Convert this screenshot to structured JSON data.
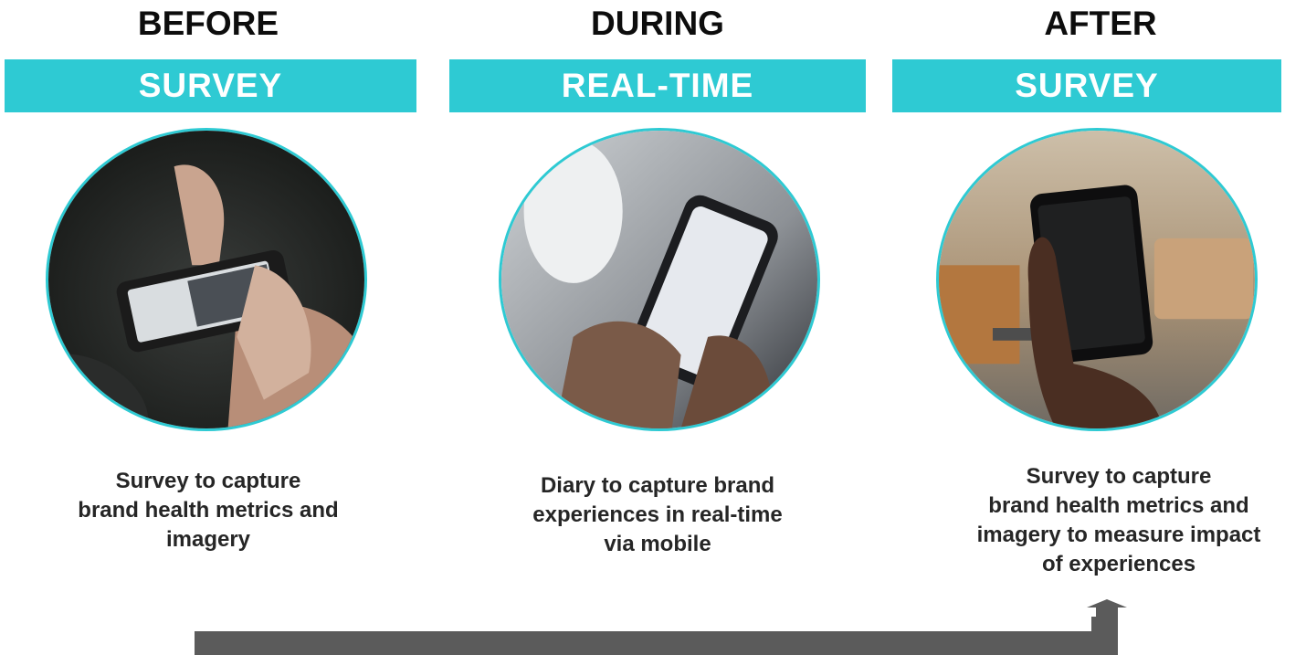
{
  "stages": [
    {
      "phase": "BEFORE",
      "method": "SURVEY",
      "image_icon": "hand-typing-on-phone-keyboard",
      "description": "Survey to capture brand health metrics  and imagery",
      "description_lines": [
        "Survey to capture",
        "brand health metrics  and",
        "imagery"
      ]
    },
    {
      "phase": "DURING",
      "method": "REAL-TIME",
      "image_icon": "hands-holding-phone-on-plane",
      "description": "Diary to capture brand experiences in real-time via mobile",
      "description_lines": [
        "Diary to capture brand",
        "experiences in real-time",
        "via mobile"
      ]
    },
    {
      "phase": "AFTER",
      "method": "SURVEY",
      "image_icon": "hand-holding-black-phone",
      "description": "Survey to capture brand health metrics and imagery to measure impact of experiences",
      "description_lines": [
        "Survey to capture",
        "brand health metrics and",
        "imagery to measure impact",
        "of experiences"
      ]
    }
  ],
  "colors": {
    "accent": "#2ecad3",
    "arrow": "#5b5b5b",
    "banner_text": "#ffffff",
    "heading": "#0d0d0d"
  }
}
